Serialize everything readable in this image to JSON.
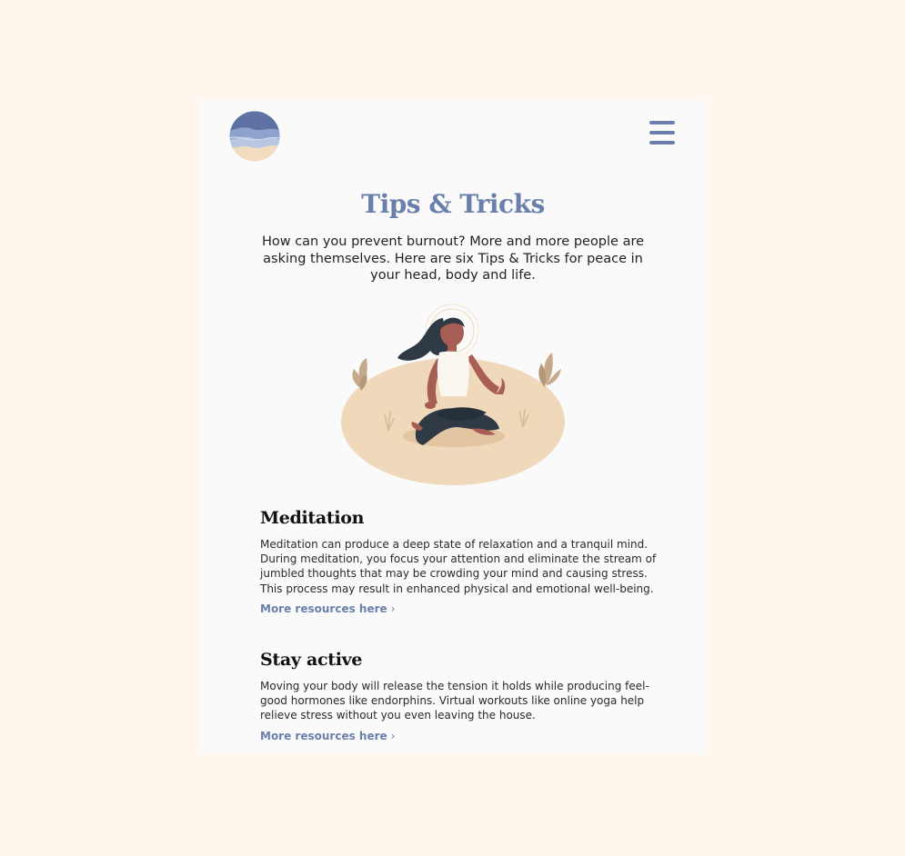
{
  "header": {
    "logo_icon": "ocean-waves-logo",
    "menu_icon": "hamburger-menu-icon"
  },
  "page": {
    "title": "Tips & Tricks",
    "intro": "How can you prevent burnout? More and more people are asking themselves. Here are six Tips & Tricks for peace in your head, body and life.",
    "illustration_icon": "meditating-woman-illustration"
  },
  "sections": [
    {
      "heading": "Meditation",
      "body": "Meditation can produce a deep state of relaxation and a tranquil mind. During meditation, you focus your attention and eliminate the stream of jumbled thoughts that may be crowding your mind and causing stress. This process may result in enhanced physical and emotional well-being.",
      "link": "More resources here",
      "link_icon": "chevron-right-icon"
    },
    {
      "heading": "Stay active",
      "body": "Moving your body will release the tension it holds while producing feel-good hormones like endorphins. Virtual workouts like online yoga help relieve stress without you even leaving the house.",
      "link": "More resources here",
      "link_icon": "chevron-right-icon"
    }
  ],
  "colors": {
    "background": "#fff6ed",
    "card": "#fafafa",
    "accent": "#6a7fab",
    "sand": "#f0d9ba"
  }
}
